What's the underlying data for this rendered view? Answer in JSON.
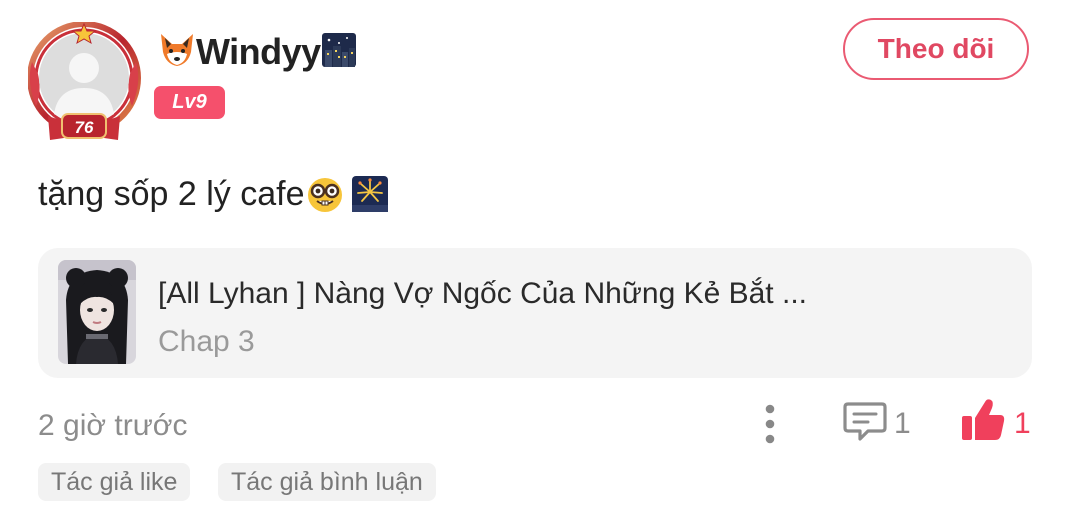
{
  "user": {
    "name_prefix_icon": "fox-emoji",
    "name": "Windyy",
    "name_suffix_icon": "night-city-emoji",
    "level": "Lv9",
    "frame_number": "76"
  },
  "follow_button": {
    "label": "Theo dõi"
  },
  "post": {
    "text": "tặng sốp 2 lý cafe",
    "emojis": [
      "nerd-face-emoji",
      "fireworks-emoji"
    ]
  },
  "story": {
    "title": "[All Lyhan ] Nàng Vợ Ngốc Của Những Kẻ Bắt ...",
    "chapter": "Chap 3"
  },
  "meta": {
    "time": "2 giờ trước",
    "comment_count": "1",
    "like_count": "1"
  },
  "tags": [
    {
      "label": "Tác giả like"
    },
    {
      "label": "Tác giả bình luận"
    }
  ],
  "colors": {
    "accent": "#f0405c",
    "follow_border": "#ea5a72",
    "badge_bg": "#f5506c",
    "muted_text": "#8c8c8c",
    "card_bg": "#f4f4f4"
  }
}
